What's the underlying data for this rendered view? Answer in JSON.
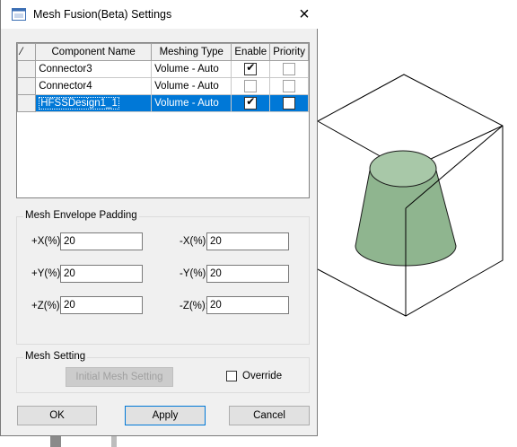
{
  "window": {
    "title": "Mesh Fusion(Beta) Settings",
    "close_symbol": "×",
    "icon": "app-window-icon"
  },
  "grid": {
    "corner_symbol": "⁄",
    "columns": [
      "Component Name",
      "Meshing Type",
      "Enable",
      "Priority"
    ],
    "rows": [
      {
        "name": "Connector3",
        "meshing_type": "Volume - Auto",
        "enable": true,
        "priority": false,
        "selected": false
      },
      {
        "name": "Connector4",
        "meshing_type": "Volume - Auto",
        "enable": false,
        "priority": false,
        "selected": false
      },
      {
        "name": "HFSSDesign1_1",
        "meshing_type": "Volume - Auto",
        "enable": true,
        "priority": false,
        "selected": true
      }
    ]
  },
  "padding": {
    "title": "Mesh Envelope Padding",
    "px_label": "+X(%):",
    "px_value": "20",
    "nx_label": "-X(%):",
    "nx_value": "20",
    "py_label": "+Y(%):",
    "py_value": "20",
    "ny_label": "-Y(%):",
    "ny_value": "20",
    "pz_label": "+Z(%):",
    "pz_value": "20",
    "nz_label": "-Z(%):",
    "nz_value": "20"
  },
  "mesh_setting": {
    "title": "Mesh Setting",
    "initial_button": "Initial Mesh Setting",
    "override_label": "Override",
    "override_checked": false
  },
  "buttons": {
    "ok": "OK",
    "apply": "Apply",
    "cancel": "Cancel"
  },
  "colors": {
    "selection": "#0078d7",
    "cone_fill": "#8fb58f"
  }
}
